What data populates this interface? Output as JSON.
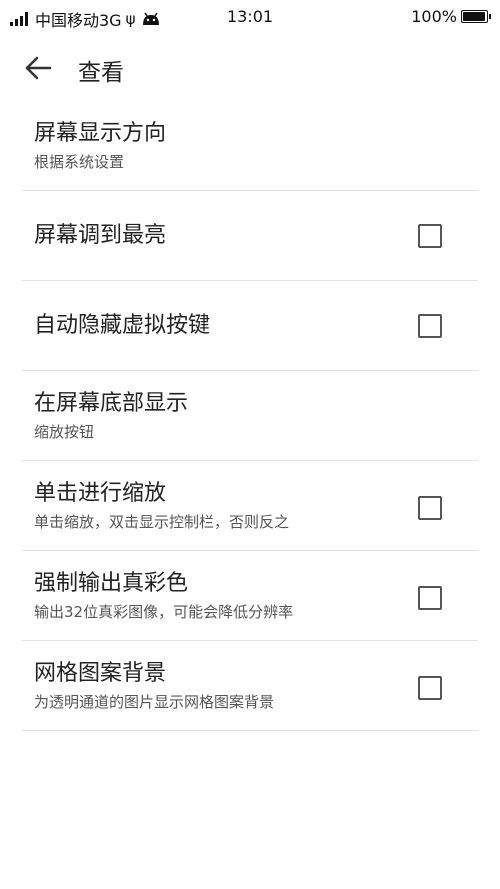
{
  "status_bar": {
    "carrier": "中国移动3G",
    "time": "13:01",
    "battery": "100%",
    "battery_level": 1.0,
    "icons": [
      "signal-icon",
      "usb-icon",
      "android-debug-icon",
      "battery-icon"
    ]
  },
  "header": {
    "title": "查看",
    "back_icon": "arrow-left-icon"
  },
  "settings": [
    {
      "title": "屏幕显示方向",
      "subtitle": "根据系统设置",
      "checkbox": false
    },
    {
      "title": "屏幕调到最亮",
      "subtitle": "",
      "checkbox": true,
      "checked": false
    },
    {
      "title": "自动隐藏虚拟按键",
      "subtitle": "",
      "checkbox": true,
      "checked": false
    },
    {
      "title": "在屏幕底部显示",
      "subtitle": "缩放按钮",
      "checkbox": false
    },
    {
      "title": "单击进行缩放",
      "subtitle": "单击缩放，双击显示控制栏，否则反之",
      "checkbox": true,
      "checked": false
    },
    {
      "title": "强制输出真彩色",
      "subtitle": "输出32位真彩图像，可能会降低分辨率",
      "checkbox": true,
      "checked": false
    },
    {
      "title": "网格图案背景",
      "subtitle": "为透明通道的图片显示网格图案背景",
      "checkbox": true,
      "checked": false
    }
  ],
  "colors": {
    "text": "#222222",
    "subtext": "#555555",
    "divider": "#e3e3e3",
    "checkbox_border": "#555555"
  }
}
